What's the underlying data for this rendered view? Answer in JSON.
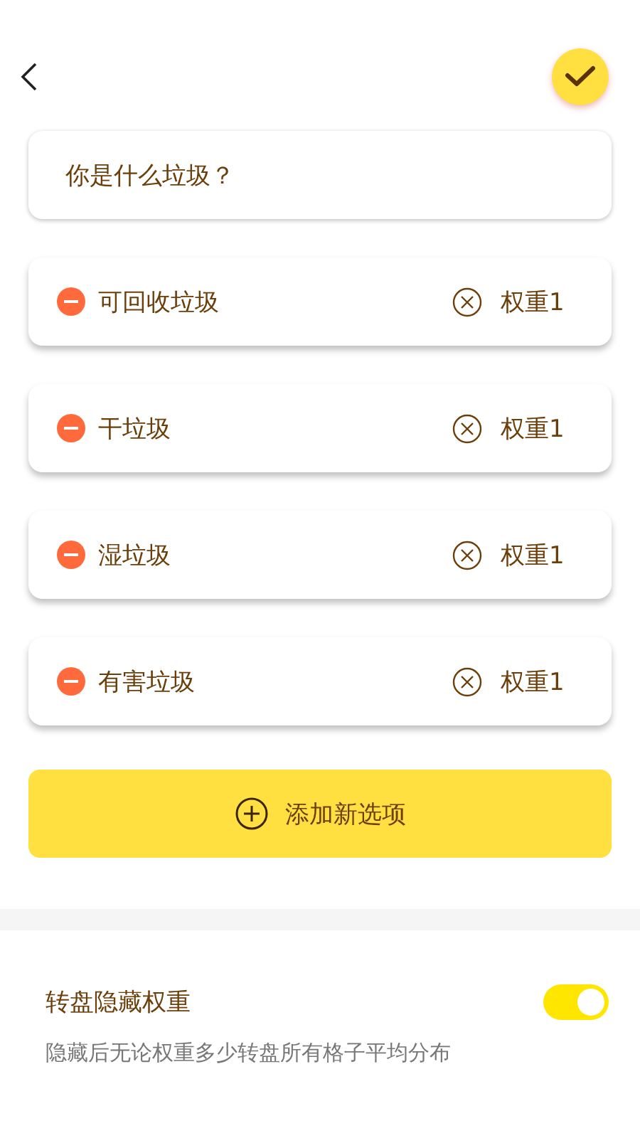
{
  "question": {
    "value": "你是什么垃圾？"
  },
  "options": [
    {
      "label": "可回收垃圾",
      "weight": "权重1"
    },
    {
      "label": "干垃圾",
      "weight": "权重1"
    },
    {
      "label": "湿垃圾",
      "weight": "权重1"
    },
    {
      "label": "有害垃圾",
      "weight": "权重1"
    }
  ],
  "add_button": {
    "label": "添加新选项"
  },
  "setting": {
    "title": "转盘隐藏权重",
    "description": "隐藏后无论权重多少转盘所有格子平均分布",
    "on": true
  }
}
